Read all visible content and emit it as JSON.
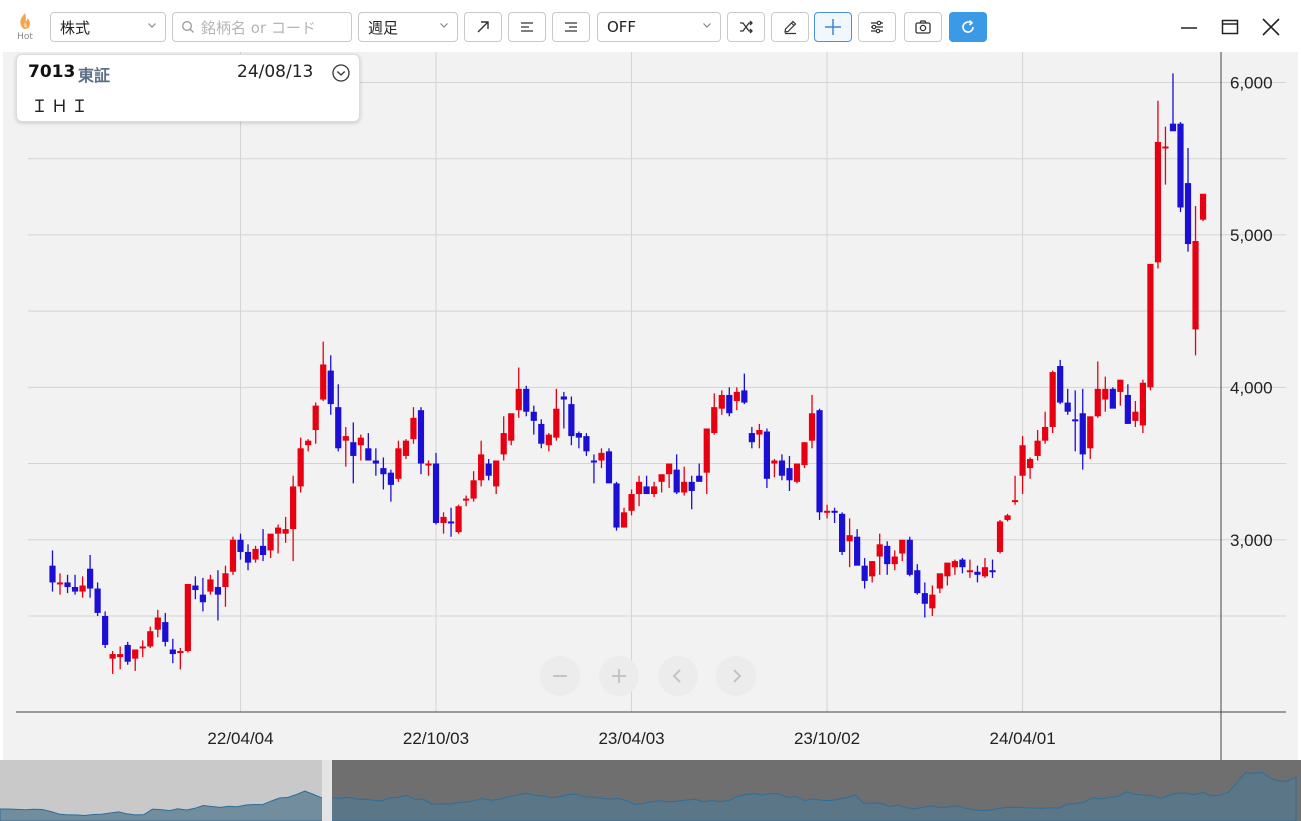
{
  "toolbar": {
    "hot_label": "Hot",
    "type_select": "株式",
    "search_placeholder": "銘柄名 or コード",
    "period_select": "週足",
    "indicator_select": "OFF"
  },
  "info": {
    "code": "7013",
    "market": "東証",
    "date": "24/08/13",
    "name": "ＩＨＩ"
  },
  "colors": {
    "up": "#e60012",
    "down": "#1c0fd4",
    "accent": "#3a9ae6",
    "grid": "#d4d4d4"
  },
  "icons": [
    "flame-icon",
    "search-icon",
    "chevron-down-icon",
    "trend-line-icon",
    "horizontal-line-icon",
    "price-line-icon",
    "shuffle-icon",
    "pencil-icon",
    "crosshair-icon",
    "settings-sliders-icon",
    "camera-icon",
    "refresh-icon",
    "minimize-icon",
    "maximize-icon",
    "close-icon",
    "zoom-out-icon",
    "zoom-in-icon",
    "scroll-left-icon",
    "scroll-right-icon"
  ],
  "chart_data": {
    "type": "candlestick",
    "ylim": [
      1870,
      6200
    ],
    "y_ticks": [
      3000,
      4000,
      5000,
      6000
    ],
    "y_tick_labels": [
      "3,000",
      "4,000",
      "5,000",
      "6,000"
    ],
    "x_ticks": [
      {
        "label": "22/04/04",
        "index": 25
      },
      {
        "label": "22/10/03",
        "index": 51
      },
      {
        "label": "23/04/03",
        "index": 77
      },
      {
        "label": "23/10/02",
        "index": 103
      },
      {
        "label": "24/04/01",
        "index": 129
      }
    ],
    "grid": true,
    "candles": [
      [
        2830,
        2930,
        2660,
        2720
      ],
      [
        2710,
        2780,
        2640,
        2720
      ],
      [
        2720,
        2770,
        2650,
        2690
      ],
      [
        2690,
        2770,
        2640,
        2660
      ],
      [
        2660,
        2760,
        2620,
        2700
      ],
      [
        2810,
        2900,
        2620,
        2680
      ],
      [
        2680,
        2720,
        2500,
        2520
      ],
      [
        2500,
        2530,
        2290,
        2310
      ],
      [
        2220,
        2270,
        2120,
        2250
      ],
      [
        2230,
        2300,
        2150,
        2250
      ],
      [
        2310,
        2330,
        2180,
        2200
      ],
      [
        2220,
        2270,
        2140,
        2280
      ],
      [
        2290,
        2340,
        2230,
        2300
      ],
      [
        2300,
        2430,
        2290,
        2400
      ],
      [
        2410,
        2540,
        2360,
        2490
      ],
      [
        2460,
        2520,
        2300,
        2330
      ],
      [
        2280,
        2350,
        2190,
        2250
      ],
      [
        2260,
        2290,
        2150,
        2270
      ],
      [
        2270,
        2550,
        2260,
        2710
      ],
      [
        2700,
        2760,
        2610,
        2670
      ],
      [
        2640,
        2750,
        2530,
        2590
      ],
      [
        2660,
        2770,
        2640,
        2740
      ],
      [
        2690,
        2800,
        2470,
        2640
      ],
      [
        2690,
        2830,
        2560,
        2780
      ],
      [
        2790,
        3020,
        2770,
        3000
      ],
      [
        3000,
        3040,
        2870,
        2920
      ],
      [
        2920,
        2970,
        2800,
        2850
      ],
      [
        2870,
        2960,
        2850,
        2940
      ],
      [
        2960,
        3070,
        2860,
        2900
      ],
      [
        2930,
        3000,
        2880,
        3040
      ],
      [
        3040,
        3100,
        2910,
        3080
      ],
      [
        3040,
        3150,
        2980,
        3070
      ],
      [
        3070,
        3420,
        2860,
        3350
      ],
      [
        3350,
        3670,
        3310,
        3600
      ],
      [
        3620,
        3660,
        3580,
        3650
      ],
      [
        3720,
        3900,
        3630,
        3880
      ],
      [
        3920,
        4300,
        3910,
        4150
      ],
      [
        4110,
        4210,
        3820,
        3890
      ],
      [
        3870,
        4020,
        3580,
        3600
      ],
      [
        3650,
        3740,
        3480,
        3680
      ],
      [
        3640,
        3770,
        3370,
        3550
      ],
      [
        3620,
        3690,
        3520,
        3670
      ],
      [
        3600,
        3700,
        3550,
        3520
      ],
      [
        3520,
        3600,
        3420,
        3500
      ],
      [
        3470,
        3540,
        3330,
        3430
      ],
      [
        3440,
        3460,
        3250,
        3360
      ],
      [
        3400,
        3650,
        3380,
        3600
      ],
      [
        3550,
        3660,
        3530,
        3650
      ],
      [
        3660,
        3870,
        3630,
        3800
      ],
      [
        3850,
        3870,
        3430,
        3500
      ],
      [
        3500,
        3520,
        3420,
        3500
      ],
      [
        3500,
        3570,
        3100,
        3110
      ],
      [
        3110,
        3180,
        3040,
        3150
      ],
      [
        3120,
        3210,
        3020,
        3110
      ],
      [
        3050,
        3230,
        3040,
        3220
      ],
      [
        3260,
        3290,
        3220,
        3270
      ],
      [
        3270,
        3450,
        3250,
        3390
      ],
      [
        3390,
        3650,
        3350,
        3560
      ],
      [
        3500,
        3530,
        3390,
        3420
      ],
      [
        3350,
        3520,
        3300,
        3520
      ],
      [
        3560,
        3810,
        3520,
        3700
      ],
      [
        3650,
        3750,
        3620,
        3830
      ],
      [
        3850,
        4130,
        3800,
        3990
      ],
      [
        3990,
        4010,
        3810,
        3840
      ],
      [
        3840,
        3880,
        3690,
        3780
      ],
      [
        3760,
        3790,
        3600,
        3630
      ],
      [
        3620,
        3700,
        3580,
        3690
      ],
      [
        3670,
        3990,
        3650,
        3860
      ],
      [
        3940,
        3970,
        3730,
        3920
      ],
      [
        3890,
        3940,
        3620,
        3680
      ],
      [
        3700,
        3710,
        3600,
        3670
      ],
      [
        3680,
        3700,
        3550,
        3580
      ],
      [
        3520,
        3560,
        3370,
        3510
      ],
      [
        3520,
        3600,
        3470,
        3570
      ],
      [
        3580,
        3600,
        3390,
        3370
      ],
      [
        3370,
        3380,
        3060,
        3080
      ],
      [
        3080,
        3210,
        3080,
        3180
      ],
      [
        3190,
        3330,
        3160,
        3300
      ],
      [
        3300,
        3420,
        3220,
        3380
      ],
      [
        3350,
        3420,
        3300,
        3300
      ],
      [
        3300,
        3380,
        3280,
        3350
      ],
      [
        3380,
        3410,
        3310,
        3430
      ],
      [
        3430,
        3460,
        3340,
        3500
      ],
      [
        3460,
        3560,
        3300,
        3310
      ],
      [
        3310,
        3480,
        3290,
        3380
      ],
      [
        3380,
        3420,
        3200,
        3320
      ],
      [
        3420,
        3500,
        3390,
        3380
      ],
      [
        3440,
        3500,
        3300,
        3730
      ],
      [
        3700,
        3960,
        3690,
        3870
      ],
      [
        3860,
        3980,
        3820,
        3950
      ],
      [
        3950,
        4000,
        3810,
        3830
      ],
      [
        3910,
        4000,
        3850,
        3970
      ],
      [
        3980,
        4090,
        3890,
        3900
      ],
      [
        3700,
        3740,
        3600,
        3640
      ],
      [
        3690,
        3760,
        3600,
        3720
      ],
      [
        3710,
        3730,
        3340,
        3400
      ],
      [
        3500,
        3530,
        3410,
        3520
      ],
      [
        3520,
        3560,
        3390,
        3420
      ],
      [
        3470,
        3550,
        3320,
        3390
      ],
      [
        3380,
        3500,
        3370,
        3500
      ],
      [
        3490,
        3640,
        3470,
        3640
      ],
      [
        3650,
        3950,
        3600,
        3830
      ],
      [
        3850,
        3860,
        3130,
        3180
      ],
      [
        3180,
        3230,
        3140,
        3190
      ],
      [
        3190,
        3210,
        3110,
        3180
      ],
      [
        3170,
        3180,
        2900,
        2920
      ],
      [
        2990,
        3140,
        2820,
        3030
      ],
      [
        3020,
        3070,
        2850,
        2830
      ],
      [
        2830,
        2880,
        2680,
        2730
      ],
      [
        2760,
        2860,
        2720,
        2860
      ],
      [
        2890,
        3040,
        2770,
        2970
      ],
      [
        2960,
        2990,
        2770,
        2840
      ],
      [
        2840,
        2930,
        2800,
        2890
      ],
      [
        2910,
        2940,
        2860,
        3000
      ],
      [
        3000,
        3020,
        2760,
        2770
      ],
      [
        2800,
        2840,
        2640,
        2650
      ],
      [
        2650,
        2720,
        2490,
        2580
      ],
      [
        2550,
        2700,
        2500,
        2640
      ],
      [
        2680,
        2750,
        2650,
        2780
      ],
      [
        2760,
        2850,
        2700,
        2850
      ],
      [
        2820,
        2870,
        2770,
        2860
      ],
      [
        2870,
        2880,
        2780,
        2820
      ],
      [
        2800,
        2870,
        2750,
        2800
      ],
      [
        2790,
        2830,
        2720,
        2770
      ],
      [
        2760,
        2880,
        2750,
        2820
      ],
      [
        2800,
        2870,
        2750,
        2790
      ],
      [
        2920,
        3130,
        2910,
        3120
      ],
      [
        3130,
        3170,
        3120,
        3160
      ],
      [
        3250,
        3420,
        3230,
        3260
      ],
      [
        3420,
        3680,
        3300,
        3620
      ],
      [
        3470,
        3540,
        3400,
        3530
      ],
      [
        3550,
        3720,
        3520,
        3650
      ],
      [
        3650,
        3840,
        3630,
        3740
      ],
      [
        3740,
        4110,
        3700,
        4100
      ],
      [
        4140,
        4180,
        3890,
        3900
      ],
      [
        3900,
        3990,
        3820,
        3840
      ],
      [
        3790,
        3980,
        3580,
        3780
      ],
      [
        3830,
        3990,
        3460,
        3560
      ],
      [
        3600,
        3690,
        3530,
        3810
      ],
      [
        3810,
        4170,
        3800,
        3990
      ],
      [
        3920,
        4070,
        3840,
        3990
      ],
      [
        3990,
        4000,
        3950,
        3860
      ],
      [
        3970,
        4050,
        3880,
        4050
      ],
      [
        3950,
        4020,
        3760,
        3760
      ],
      [
        3780,
        3910,
        3740,
        3840
      ],
      [
        3750,
        4050,
        3700,
        4030
      ],
      [
        4000,
        4070,
        3980,
        4810
      ],
      [
        4820,
        5880,
        4780,
        5610
      ],
      [
        5570,
        5710,
        5330,
        5580
      ],
      [
        5730,
        6060,
        5720,
        5680
      ],
      [
        5730,
        5740,
        5150,
        5180
      ],
      [
        5340,
        5570,
        4890,
        4940
      ],
      [
        4380,
        5190,
        4210,
        4960
      ],
      [
        5100,
        5230,
        5090,
        5270
      ]
    ]
  }
}
